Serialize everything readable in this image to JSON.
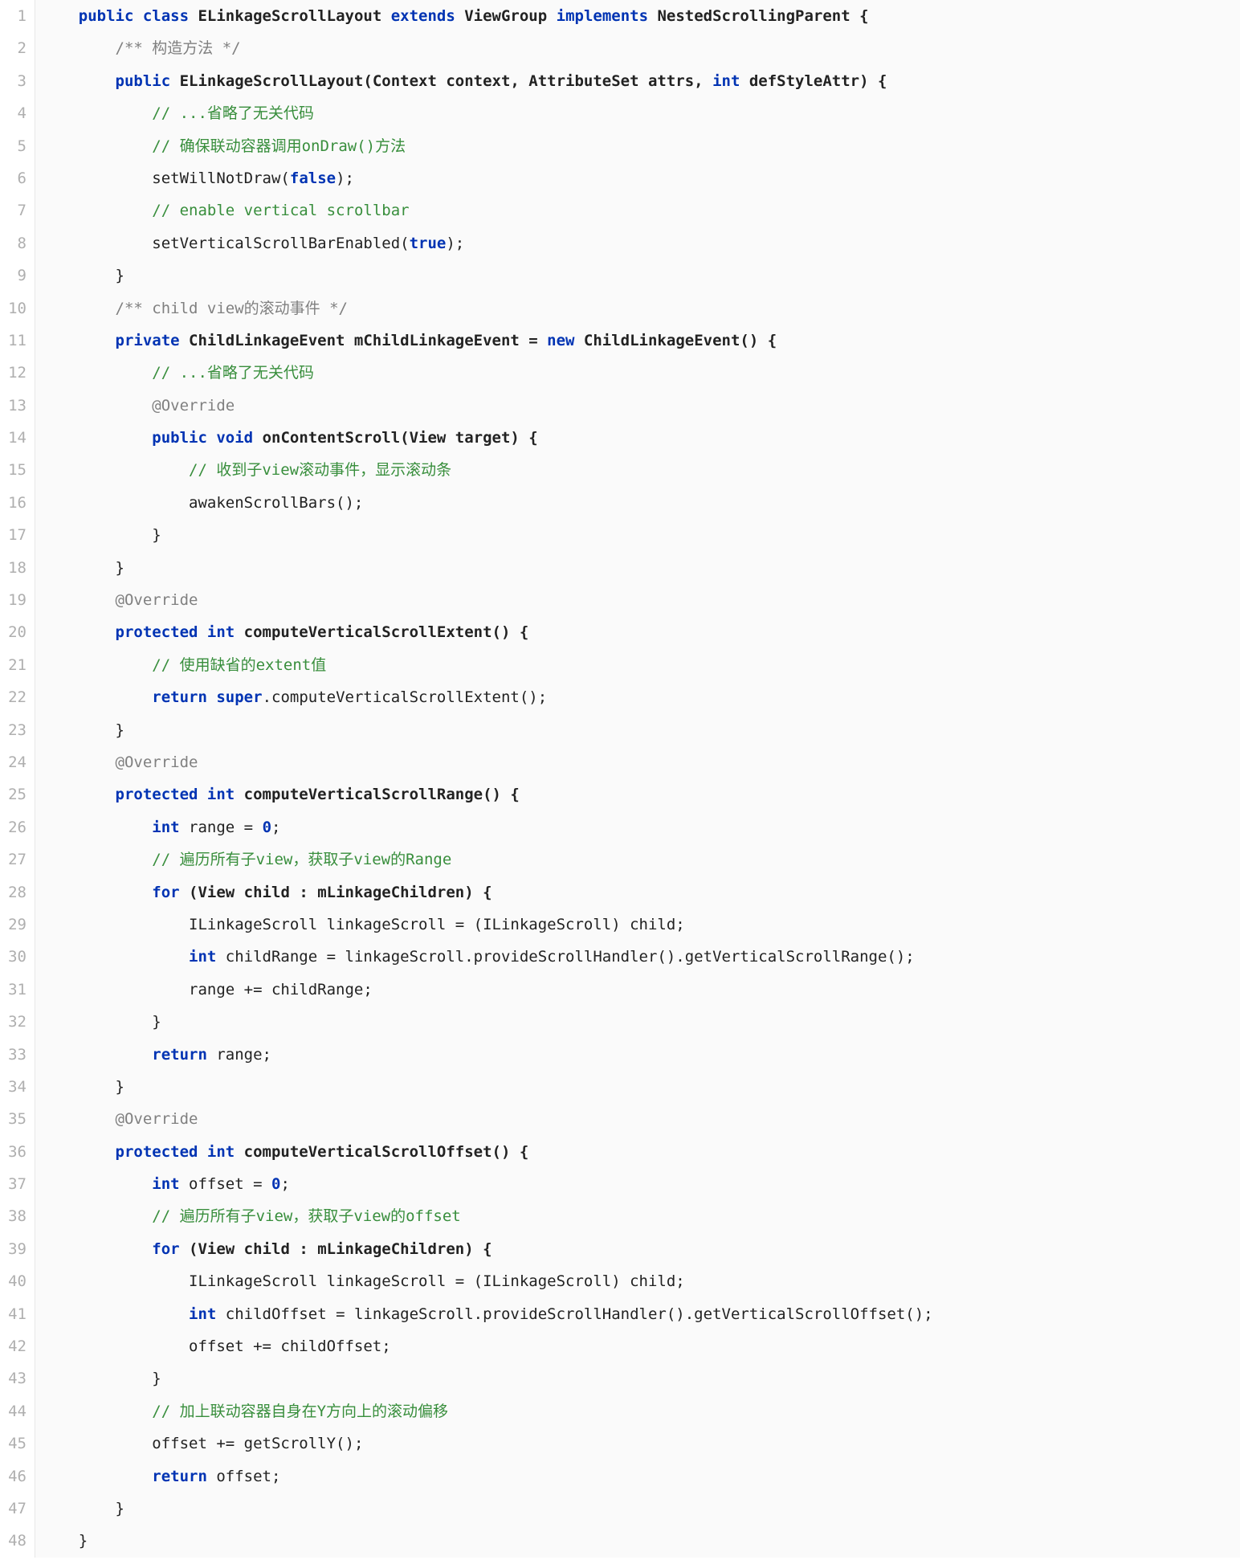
{
  "lines": {
    "n1": "1",
    "n2": "2",
    "n3": "3",
    "n4": "4",
    "n5": "5",
    "n6": "6",
    "n7": "7",
    "n8": "8",
    "n9": "9",
    "n10": "10",
    "n11": "11",
    "n12": "12",
    "n13": "13",
    "n14": "14",
    "n15": "15",
    "n16": "16",
    "n17": "17",
    "n18": "18",
    "n19": "19",
    "n20": "20",
    "n21": "21",
    "n22": "22",
    "n23": "23",
    "n24": "24",
    "n25": "25",
    "n26": "26",
    "n27": "27",
    "n28": "28",
    "n29": "29",
    "n30": "30",
    "n31": "31",
    "n32": "32",
    "n33": "33",
    "n34": "34",
    "n35": "35",
    "n36": "36",
    "n37": "37",
    "n38": "38",
    "n39": "39",
    "n40": "40",
    "n41": "41",
    "n42": "42",
    "n43": "43",
    "n44": "44",
    "n45": "45",
    "n46": "46",
    "n47": "47",
    "n48": "48"
  },
  "t": {
    "l1a": "public",
    "l1b": " class",
    "l1c": " ELinkageScrollLayout ",
    "l1d": "extends",
    "l1e": " ViewGroup ",
    "l1f": "implements",
    "l1g": " NestedScrollingParent {",
    "l2": "/** 构造方法 */",
    "l3a": "public",
    "l3b": " ELinkageScrollLayout(Context context, AttributeSet attrs, ",
    "l3c": "int",
    "l3d": " defStyleAttr) {",
    "l4": "// ...省略了无关代码",
    "l5": "// 确保联动容器调用onDraw()方法",
    "l6a": "setWillNotDraw(",
    "l6b": "false",
    "l6c": ");",
    "l7": "// enable vertical scrollbar",
    "l8a": "setVerticalScrollBarEnabled(",
    "l8b": "true",
    "l8c": ");",
    "l9": "}",
    "l10": "/** child view的滚动事件 */",
    "l11a": "private",
    "l11b": " ChildLinkageEvent mChildLinkageEvent = ",
    "l11c": "new",
    "l11d": " ChildLinkageEvent() {",
    "l12": "// ...省略了无关代码",
    "l13": "@Override",
    "l14a": "public",
    "l14b": " void",
    "l14c": " onContentScroll",
    "l14d": "(View target) {",
    "l15": "// 收到子view滚动事件，显示滚动条",
    "l16": "awakenScrollBars();",
    "l17": "}",
    "l18": "}",
    "l19": "@Override",
    "l20a": "protected",
    "l20b": " int",
    "l20c": " computeVerticalScrollExtent",
    "l20d": "() {",
    "l21": "// 使用缺省的extent值",
    "l22a": "return",
    "l22b": " super",
    "l22c": ".computeVerticalScrollExtent();",
    "l23": "}",
    "l24": "@Override",
    "l25a": "protected",
    "l25b": " int",
    "l25c": " computeVerticalScrollRange",
    "l25d": "() {",
    "l26a": "int",
    "l26b": " range = ",
    "l26c": "0",
    "l26d": ";",
    "l27": "// 遍历所有子view，获取子view的Range",
    "l28a": "for",
    "l28b": " (View child : mLinkageChildren) {",
    "l29": "ILinkageScroll linkageScroll = (ILinkageScroll) child;",
    "l30a": "int",
    "l30b": " childRange = linkageScroll.provideScrollHandler().getVerticalScrollRange();",
    "l31": "range += childRange;",
    "l32": "}",
    "l33a": "return",
    "l33b": " range;",
    "l34": "}",
    "l35": "@Override",
    "l36a": "protected",
    "l36b": " int",
    "l36c": " computeVerticalScrollOffset",
    "l36d": "() {",
    "l37a": "int",
    "l37b": " offset = ",
    "l37c": "0",
    "l37d": ";",
    "l38": "// 遍历所有子view，获取子view的offset",
    "l39a": "for",
    "l39b": " (View child : mLinkageChildren) {",
    "l40": "ILinkageScroll linkageScroll = (ILinkageScroll) child;",
    "l41a": "int",
    "l41b": " childOffset = linkageScroll.provideScrollHandler().getVerticalScrollOffset();",
    "l42": "offset += childOffset;",
    "l43": "}",
    "l44": "// 加上联动容器自身在Y方向上的滚动偏移",
    "l45": "offset += getScrollY();",
    "l46a": "return",
    "l46b": " offset;",
    "l47": "}",
    "l48": "}"
  },
  "ind": {
    "i0": "",
    "i1": "    ",
    "i2": "        ",
    "i3": "            ",
    "i4": "                "
  }
}
